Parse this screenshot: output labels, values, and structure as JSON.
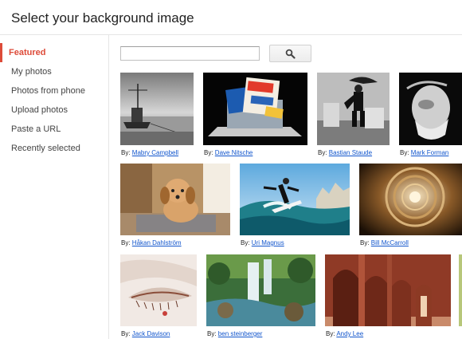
{
  "header": {
    "title": "Select your background image"
  },
  "sidebar": {
    "items": [
      {
        "label": "Featured",
        "active": true
      },
      {
        "label": "My photos"
      },
      {
        "label": "Photos from phone"
      },
      {
        "label": "Upload photos"
      },
      {
        "label": "Paste a URL"
      },
      {
        "label": "Recently selected"
      }
    ]
  },
  "search": {
    "value": "",
    "placeholder": "",
    "button_icon": "search-icon"
  },
  "gallery": {
    "by_label": "By:",
    "photos": [
      {
        "author": "Mabry Campbell",
        "subject": "boat-harbor-bw"
      },
      {
        "author": "Dave Nitsche",
        "subject": "laptop-books"
      },
      {
        "author": "Bastian Staude",
        "subject": "boy-umbrella-bw"
      },
      {
        "author": "Mark Forman",
        "subject": "old-man-bw"
      },
      {
        "author": "Håkan Dahlström",
        "subject": "puppy"
      },
      {
        "author": "Uri Magnus",
        "subject": "surfer"
      },
      {
        "author": "Bill McCarroll",
        "subject": "spiral-staircase"
      },
      {
        "author": "Jack Davison",
        "subject": "eye-closeup"
      },
      {
        "author": "ben steinberger",
        "subject": "waterfall"
      },
      {
        "author": "Andy Lee",
        "subject": "red-arches"
      }
    ]
  },
  "colors": {
    "accent": "#dd4b39",
    "link": "#1155cc",
    "divider": "#e5e5e5"
  }
}
